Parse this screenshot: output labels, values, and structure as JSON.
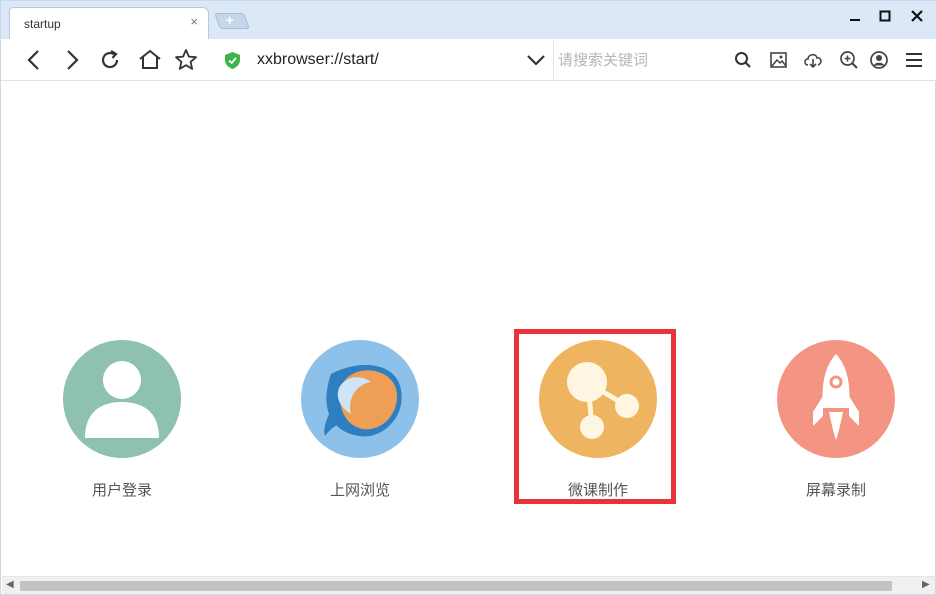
{
  "tab": {
    "title": "startup",
    "close": "×"
  },
  "newtab": {
    "label": "+"
  },
  "window_controls": {
    "minimize": "−",
    "maximize": "□",
    "close": "✕"
  },
  "address": {
    "url": "xxbrowser://start/"
  },
  "search": {
    "placeholder": "请搜索关键词"
  },
  "apps": [
    {
      "label": "用户登录",
      "icon": "user-icon",
      "color": "#8fc1b1"
    },
    {
      "label": "上网浏览",
      "icon": "browser-logo-icon",
      "color": "#8dc1ea"
    },
    {
      "label": "微课制作",
      "icon": "share-nodes-icon",
      "color": "#efb45f"
    },
    {
      "label": "屏幕录制",
      "icon": "rocket-icon",
      "color": "#f49583"
    }
  ],
  "highlight_color": "#e8333a"
}
